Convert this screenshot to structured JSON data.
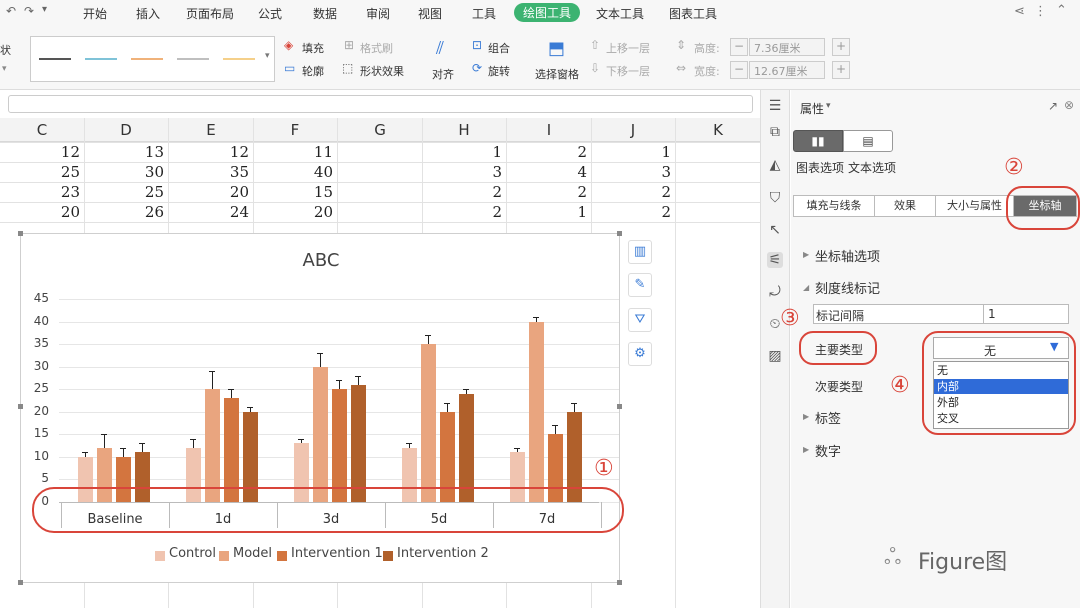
{
  "ribbon": {
    "left_stub": "状",
    "menus": [
      "开始",
      "插入",
      "页面布局",
      "公式",
      "数据",
      "审阅",
      "视图",
      "工具",
      "绘图工具",
      "文本工具",
      "图表工具"
    ],
    "active_menu": "绘图工具",
    "fill": "填充",
    "format_painter": "格式刷",
    "outline": "轮廓",
    "shape_effect": "形状效果",
    "align": "对齐",
    "group": "组合",
    "rotate": "旋转",
    "selection_pane": "选择窗格",
    "bring_forward": "上移一层",
    "send_backward": "下移一层",
    "height_label": "高度:",
    "height_value": "7.36厘米",
    "width_label": "宽度:",
    "width_value": "12.67厘米",
    "line_colors": [
      "#555555",
      "#7fc3d8",
      "#f0b27a",
      "#bfbfbf",
      "#f5d08a"
    ]
  },
  "sheet": {
    "columns": [
      "C",
      "D",
      "E",
      "F",
      "G",
      "H",
      "I",
      "J",
      "K"
    ],
    "rows": [
      [
        "12",
        "13",
        "12",
        "11",
        "",
        "1",
        "2",
        "1"
      ],
      [
        "25",
        "30",
        "35",
        "40",
        "",
        "3",
        "4",
        "3"
      ],
      [
        "23",
        "25",
        "20",
        "15",
        "",
        "2",
        "2",
        "2"
      ],
      [
        "20",
        "26",
        "24",
        "20",
        "",
        "2",
        "1",
        "2"
      ]
    ]
  },
  "chart_data": {
    "type": "bar",
    "title": "ABC",
    "categories": [
      "Baseline",
      "1d",
      "3d",
      "5d",
      "7d"
    ],
    "series": [
      {
        "name": "Control",
        "values": [
          10,
          12,
          13,
          12,
          11
        ],
        "errors": [
          1,
          2,
          1,
          1,
          1
        ],
        "color": "#f0c4b0"
      },
      {
        "name": "Model",
        "values": [
          12,
          25,
          30,
          35,
          40
        ],
        "errors": [
          3,
          4,
          3,
          2,
          1
        ],
        "color": "#e9a57f"
      },
      {
        "name": "Intervention 1",
        "values": [
          10,
          23,
          25,
          20,
          15
        ],
        "errors": [
          2,
          2,
          2,
          2,
          2
        ],
        "color": "#d3753f"
      },
      {
        "name": "Intervention 2",
        "values": [
          11,
          20,
          26,
          24,
          20
        ],
        "errors": [
          2,
          1,
          2,
          1,
          2
        ],
        "color": "#b0602b"
      }
    ],
    "yticks": [
      "0",
      "5",
      "10",
      "15",
      "20",
      "25",
      "30",
      "35",
      "40",
      "45"
    ],
    "ylim": [
      0,
      45
    ],
    "grid": true,
    "legend": "bottom"
  },
  "panel": {
    "title": "属性",
    "chart_options": "图表选项",
    "text_options": "文本选项",
    "tabs": [
      "填充与线条",
      "效果",
      "大小与属性",
      "坐标轴"
    ],
    "selected_tab": "坐标轴",
    "section_axis_options": "坐标轴选项",
    "section_tick_marks": "刻度线标记",
    "mark_interval_label": "标记间隔",
    "mark_interval_value": "1",
    "major_type_label": "主要类型",
    "major_type_value": "无",
    "minor_type_label": "次要类型",
    "dropdown_options": [
      "无",
      "内部",
      "外部",
      "交叉"
    ],
    "highlighted_option": "内部",
    "section_labels": "标签",
    "section_number": "数字"
  },
  "annotations": {
    "n1": "①",
    "n2": "②",
    "n3": "③",
    "n4": "④",
    "red": "#d9453a"
  },
  "watermark": "Figure图"
}
